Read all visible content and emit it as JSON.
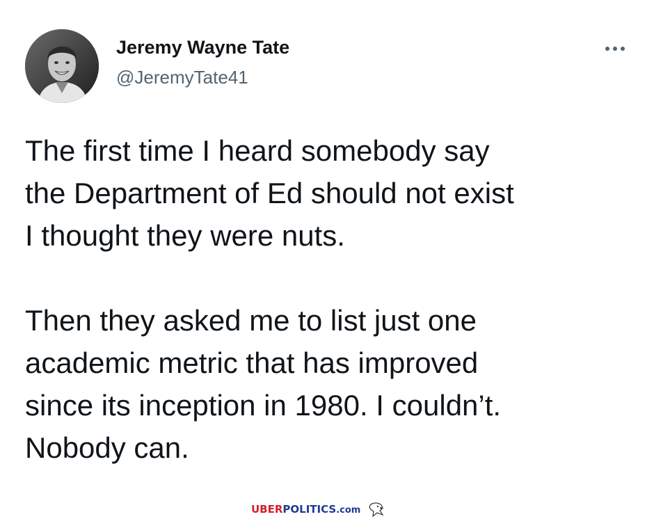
{
  "tweet": {
    "author_name": "Jeremy Wayne Tate",
    "author_handle": "@JeremyTate41",
    "more_icon": "more-horizontal-icon",
    "paragraphs": [
      "The first time I heard somebody say\nthe Department of Ed should not exist\nI thought they were nuts.",
      "Then they asked me to list just one\nacademic metric that has improved\nsince its inception in 1980. I couldn’t.\nNobody can."
    ]
  },
  "watermark": {
    "part1": "UBER",
    "part2": "POLITICS",
    "part3": ".com",
    "icon": "eagle-icon"
  },
  "colors": {
    "text": "#0f1419",
    "secondary": "#536471",
    "watermark_red": "#d0202e",
    "watermark_blue": "#1f3a93"
  }
}
